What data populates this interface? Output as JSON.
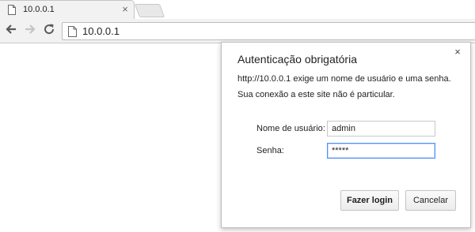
{
  "browser": {
    "tab": {
      "title": "10.0.0.1",
      "close_glyph": "×"
    },
    "address_bar": {
      "url": "10.0.0.1"
    },
    "icons": {
      "back": "back-arrow-icon",
      "forward": "forward-arrow-icon",
      "reload": "reload-icon",
      "page": "page-icon"
    }
  },
  "auth_dialog": {
    "title": "Autenticação obrigatória",
    "close_glyph": "×",
    "message_line1": "http://10.0.0.1 exige um nome de usuário e uma senha.",
    "message_line2": "Sua conexão a este site não é particular.",
    "username": {
      "label": "Nome de usuário:",
      "value": "admin"
    },
    "password": {
      "label": "Senha:",
      "value": "*****"
    },
    "login_button": "Fazer login",
    "cancel_button": "Cancelar"
  },
  "colors": {
    "focus_border": "#4d90fe",
    "chrome_bg": "#f2f2f2"
  }
}
